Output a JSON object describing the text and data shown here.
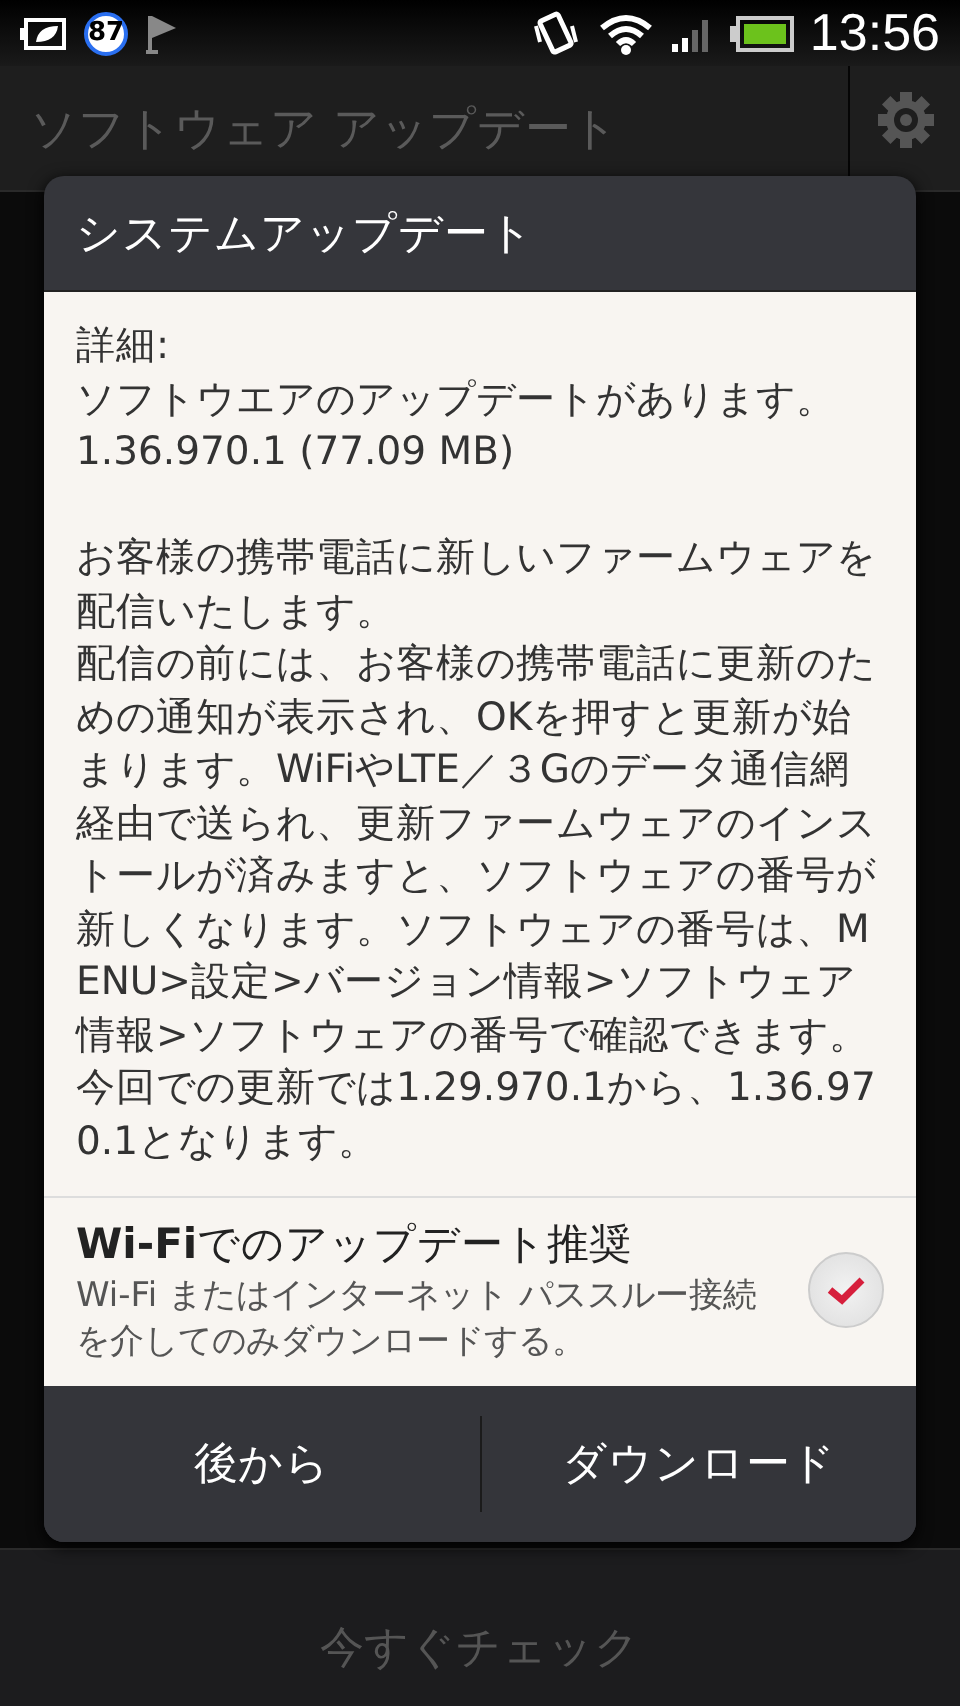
{
  "status_bar": {
    "badge": "87",
    "time": "13:56"
  },
  "action_bar": {
    "title": "ソフトウェア アップデート"
  },
  "dialog": {
    "title": "システムアップデート",
    "sections": [
      [
        "詳細:",
        "ソフトウエアのアップデートがあります。",
        "1.36.970.1 (77.09 MB)"
      ],
      [
        "お客様の携帯電話に新しいファームウェアを配信いたします。",
        "配信の前には、お客様の携帯電話に更新のための通知が表示され、OKを押すと更新が始まります。WiFiやLTE／３Gのデータ通信網経由で送られ、更新ファームウェアのインストールが済みますと、ソフトウェアの番号が新しくなります。ソフトウェアの番号は、MENU>設定>バージョン情報>ソフトウェア情報>ソフトウェアの番号で確認できます。今回での更新では1.29.970.1から、1.36.970.1となります。"
      ]
    ],
    "option": {
      "label": "**Wi-Fi**でのアップデート推奨",
      "description": "Wi-Fi またはインターネット パススルー接続を介してのみダウンロードする。",
      "checked": true
    },
    "buttons": [
      "後から",
      "ダウンロード"
    ]
  },
  "bottom_bar": {
    "button": "今すぐチェック"
  }
}
